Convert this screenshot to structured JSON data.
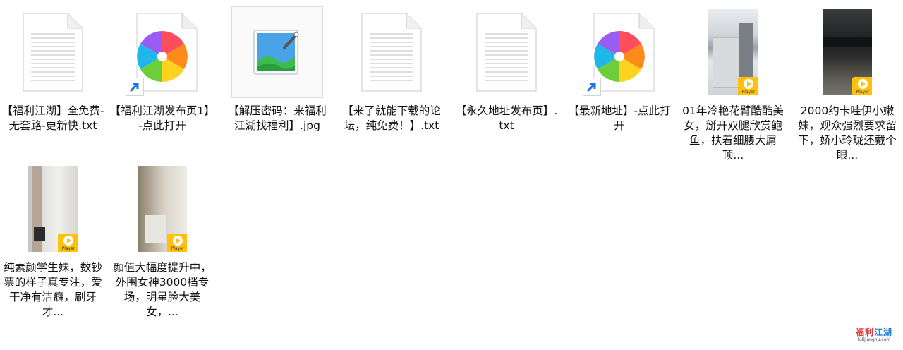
{
  "files": [
    {
      "type": "txt",
      "label": "【福利江湖】全免费-无套路-更新快.txt"
    },
    {
      "type": "shortcut",
      "label": "【福利江湖发布页1】-点此打开"
    },
    {
      "type": "jpg",
      "label": "【解压密码：来福利江湖找福利】.jpg"
    },
    {
      "type": "txt",
      "label": "【来了就能下载的论坛，纯免费！】.txt"
    },
    {
      "type": "txt",
      "label": "【永久地址发布页】.txt"
    },
    {
      "type": "shortcut",
      "label": "【最新地址】-点此打开"
    },
    {
      "type": "video",
      "label": "01年冷艳花臂酷酷美女，掰开双腿欣赏鲍鱼，扶着细腰大屌顶...",
      "badge": "Player"
    },
    {
      "type": "video",
      "label": "2000约卡哇伊小嫩妹，观众强烈要求留下，娇小玲珑还戴个眼...",
      "badge": "Player"
    },
    {
      "type": "video",
      "label": "纯素颜学生妹，数钞票的样子真专注，爱干净有洁癖，刷牙才...",
      "badge": "Player"
    },
    {
      "type": "video",
      "label": "颜值大幅度提升中，外围女神3000档专场，明星脸大美女，...",
      "badge": "Player"
    }
  ],
  "watermark": {
    "title_part1": "福利",
    "title_part2": "江湖",
    "url": "fulijianghu.com"
  },
  "colors": {
    "accent": "#1d7fd6",
    "badge": "#ffc10d"
  }
}
